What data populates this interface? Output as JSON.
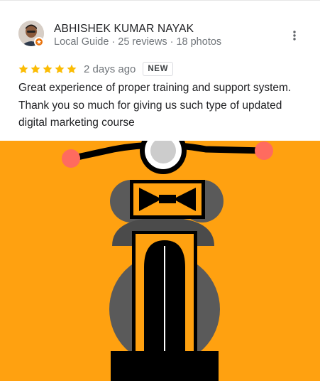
{
  "reviewer": {
    "name": "ABHISHEK KUMAR NAYAK",
    "meta": "Local Guide · 25 reviews · 18 photos",
    "badge_color": "#e8710a"
  },
  "review": {
    "stars": 5,
    "star_color": "#fbbc04",
    "date": "2 days ago",
    "badge": "NEW",
    "text": "Great experience of proper training and support system. Thank you so much for giving us such type of updated digital marketing course"
  },
  "photo": {
    "subject": "motorcycle-illustration",
    "background_color": "#ffa110"
  },
  "icons": {
    "more": "more-vert-icon",
    "star": "star-icon",
    "guide": "local-guide-badge-icon"
  }
}
